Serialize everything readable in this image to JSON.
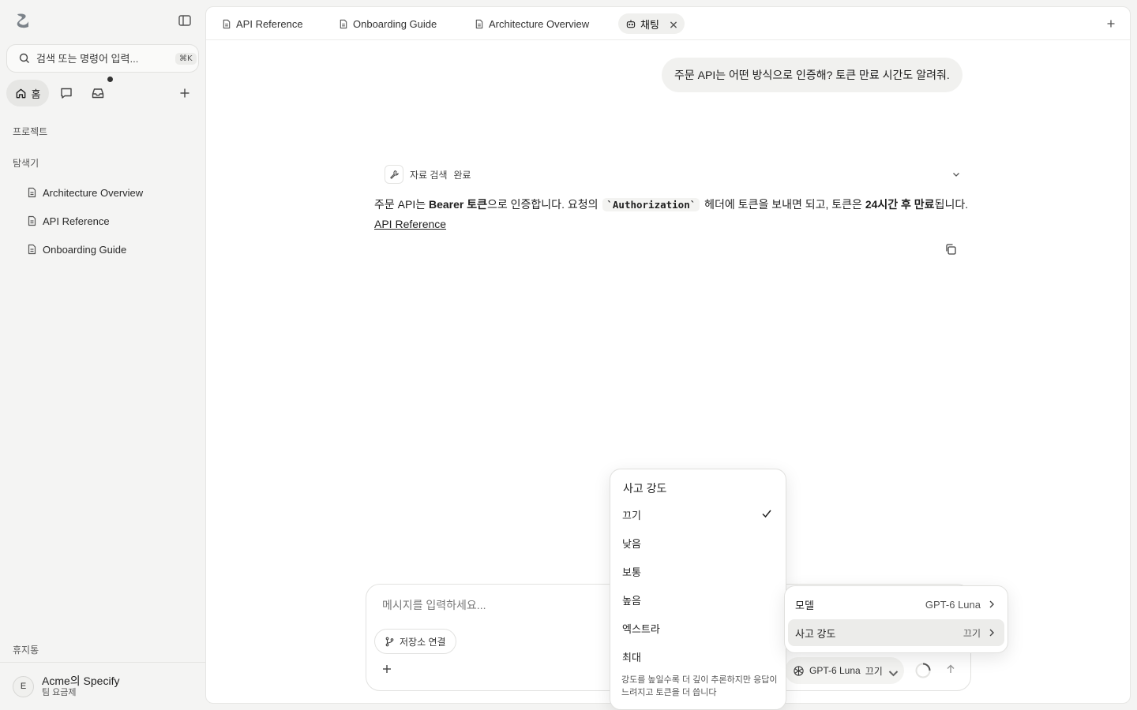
{
  "sidebar": {
    "search_placeholder": "검색 또는 명령어 입력...",
    "search_shortcut": "⌘K",
    "nav_home_label": "홈",
    "section_projects": "프로젝트",
    "section_explorer": "탐색기",
    "files": [
      {
        "label": "Architecture Overview"
      },
      {
        "label": "API Reference"
      },
      {
        "label": "Onboarding Guide"
      }
    ],
    "trash_label": "휴지통",
    "account": {
      "initial": "E",
      "name": "Acme의 Specify",
      "plan": "팀 요금제"
    }
  },
  "tabs": [
    {
      "label": "API Reference"
    },
    {
      "label": "Onboarding Guide"
    },
    {
      "label": "Architecture Overview"
    },
    {
      "label": "채팅"
    }
  ],
  "chat": {
    "user_message": "주문 API는 어떤 방식으로 인증해? 토큰 만료 시간도 알려줘.",
    "tool_label": "자료 검색",
    "tool_status": "완료",
    "answer": {
      "p1": "주문 API는 ",
      "b1": "Bearer 토큰",
      "p2": "으로 인증합니다. 요청의 ",
      "code": "`Authorization`",
      "p3": " 헤더에 토큰을 보내면 되고, 토큰은 ",
      "b2": "24시간 후 만료",
      "p4": "됩니다.",
      "link": "API Reference"
    }
  },
  "composer": {
    "placeholder": "메시지를 입력하세요...",
    "repo_button": "저장소 연결",
    "model_name": "GPT-6 Luna",
    "effort_value": "끄기"
  },
  "effort_menu": {
    "title": "사고 강도",
    "options": [
      "끄기",
      "낮음",
      "보통",
      "높음",
      "엑스트라",
      "최대"
    ],
    "selected": "끄기",
    "hint": "강도를 높일수록 더 깊이 추론하지만 응답이 느려지고 토큰을 더 씁니다"
  },
  "model_menu": {
    "model_label": "모델",
    "model_value": "GPT-6 Luna",
    "effort_label": "사고 강도",
    "effort_value": "끄기"
  }
}
